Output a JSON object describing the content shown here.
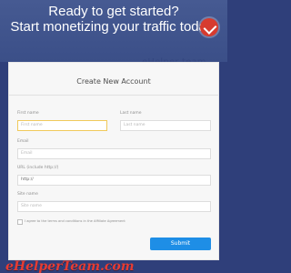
{
  "hero": {
    "line1": "Ready to get started?",
    "line2": "Start monetizing your traffic today!"
  },
  "watermark": {
    "top_text": "eHelper team",
    "bottom_text": "eHelperTeam.com"
  },
  "form": {
    "title": "Create New Account",
    "fields": {
      "first_name": {
        "label": "First name",
        "placeholder": "First name"
      },
      "last_name": {
        "label": "Last name",
        "placeholder": "Last name"
      },
      "email": {
        "label": "Email",
        "placeholder": "Email"
      },
      "url": {
        "label": "URL (include http://)",
        "value": "http://"
      },
      "site_name": {
        "label": "Site name",
        "placeholder": "Site name"
      }
    },
    "agreement": {
      "text": "I agree to the terms and conditions in the Affiliate Agreement"
    },
    "submit_label": "Submit"
  },
  "colors": {
    "hero_background": "#3b4f88",
    "submit": "#1e8ee6",
    "focus_border": "#f0c95b",
    "watermark_red": "#e73c32"
  },
  "icons": {
    "watermark_badge": "checkmark-badge-icon"
  }
}
